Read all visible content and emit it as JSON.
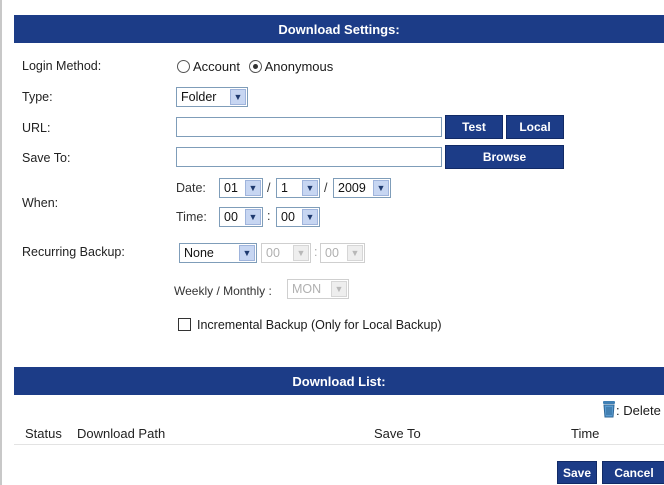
{
  "settings": {
    "title": "Download Settings:",
    "login": {
      "label": "Login Method:",
      "account": "Account",
      "anonymous": "Anonymous"
    },
    "type": {
      "label": "Type:",
      "value": "Folder"
    },
    "url": {
      "label": "URL:",
      "test": "Test",
      "local": "Local"
    },
    "save_to": {
      "label": "Save To:",
      "browse": "Browse"
    },
    "when": {
      "label": "When:",
      "date_label": "Date:",
      "month": "01",
      "day": "1",
      "year": "2009",
      "time_label": "Time:",
      "hour": "00",
      "minute": "00"
    },
    "recurring": {
      "label": "Recurring Backup:",
      "value": "None",
      "hour": "00",
      "minute": "00",
      "weekly_label": "Weekly / Monthly :",
      "weekly_value": "MON"
    },
    "incremental": "Incremental Backup (Only for Local Backup)"
  },
  "list": {
    "title": "Download List:",
    "delete_label": ": Delete",
    "columns": {
      "status": "Status",
      "path": "Download Path",
      "save_to": "Save To",
      "time": "Time"
    }
  },
  "actions": {
    "save": "Save",
    "cancel": "Cancel"
  },
  "colors": {
    "accent": "#1c3c87"
  },
  "icons": {
    "delete": "trash-icon",
    "dropdown": "chevron-down-icon"
  }
}
